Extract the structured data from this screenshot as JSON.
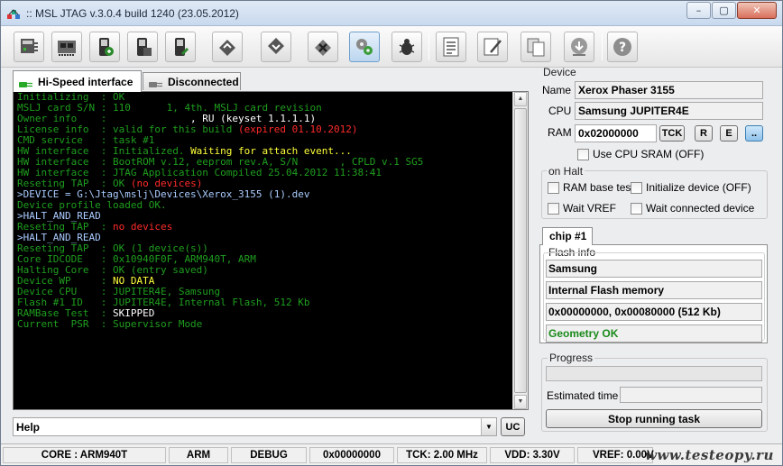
{
  "window": {
    "title": ":: MSL JTAG v.3.0.4 build 1240 (23.05.2012)",
    "controls": {
      "minimize": "–",
      "maximize": "▢",
      "close": "✕"
    }
  },
  "toolbar": {
    "buttons": [
      {
        "icon": "jtag-plug-icon"
      },
      {
        "icon": "board-chip-icon"
      },
      {
        "icon": "phone-read-icon"
      },
      {
        "icon": "phone-write-icon"
      },
      {
        "icon": "phone-erase-icon"
      },
      {
        "icon": "chip-up-icon"
      },
      {
        "icon": "chip-down-icon"
      },
      {
        "icon": "chip-x-icon"
      },
      {
        "icon": "settings-gears-icon"
      },
      {
        "icon": "bug-debug-icon"
      },
      {
        "icon": "log-list-icon"
      },
      {
        "icon": "notepad-edit-icon"
      },
      {
        "icon": "copy-pages-icon"
      },
      {
        "icon": "globe-update-icon"
      },
      {
        "icon": "help-icon"
      }
    ]
  },
  "tabs": {
    "hispeed": "Hi-Speed interface",
    "disconnected": "Disconnected"
  },
  "console": {
    "lines": [
      {
        "label": "Initializing  : ",
        "value": "OK",
        "color": "#1f9e1f"
      },
      {
        "label": "MSLJ card S/N : ",
        "value": "110      1, 4th. MSLJ card revision",
        "color": "#1f9e1f"
      },
      {
        "label": "Owner info    : ",
        "value": "             , RU (keyset 1.1.1.1)",
        "color": "#ffffff"
      },
      {
        "label": "License info  : ",
        "value": "valid for this build ",
        "color": "#1f9e1f",
        "extra": "(expired 01.10.2012)",
        "extra_color": "#ff2a2a"
      },
      {
        "label": "CMD service   : ",
        "value": "task #1",
        "color": "#1f9e1f"
      },
      {
        "label": "HW interface  : ",
        "value": "Initialized. ",
        "color": "#1f9e1f",
        "extra": "Waiting for attach event...",
        "extra_color": "#ffff3a"
      },
      {
        "label": "HW interface  : ",
        "value": "BootROM v.12, eeprom rev.A, S/N       , CPLD v.1 SG5",
        "color": "#1f9e1f"
      },
      {
        "label": "HW interface  : ",
        "value": "JTAG Application Compiled 25.04.2012 11:38:41",
        "color": "#1f9e1f"
      },
      {
        "label": "Reseting TAP  : ",
        "value": "OK ",
        "color": "#1f9e1f",
        "extra": "(no devices)",
        "extra_color": "#ff2a2a"
      },
      {
        "label": "",
        "value": ">DEVICE = G:\\Jtag\\mslj\\Devices\\Xerox_3155 (1).dev",
        "color": "#aaccff"
      },
      {
        "label": "",
        "value": "Device profile loaded OK.",
        "color": "#1f9e1f"
      },
      {
        "label": "",
        "value": ">HALT_AND_READ",
        "color": "#aaccff"
      },
      {
        "label": "Reseting TAP  : ",
        "value": "no devices",
        "color": "#ff2a2a"
      },
      {
        "label": "",
        "value": ">HALT_AND_READ",
        "color": "#aaccff"
      },
      {
        "label": "Reseting TAP  : ",
        "value": "OK (1 device(s))",
        "color": "#1f9e1f"
      },
      {
        "label": "Core IDCODE   : ",
        "value": "0x10940F0F, ARM940T, ARM",
        "color": "#1f9e1f"
      },
      {
        "label": "Halting Core  : ",
        "value": "OK (entry saved)",
        "color": "#1f9e1f"
      },
      {
        "label": "Device WP     : ",
        "value": "NO DATA",
        "color": "#ffff3a"
      },
      {
        "label": "Device CPU    : ",
        "value": "JUPITER4E, Samsung",
        "color": "#1f9e1f"
      },
      {
        "label": "Flash #1 ID   : ",
        "value": "JUPITER4E, Internal Flash, 512 Kb",
        "color": "#1f9e1f"
      },
      {
        "label": "RAMBase Test  : ",
        "value": "SKIPPED",
        "color": "#ffffff"
      },
      {
        "label": "Current  PSR  : ",
        "value": "Supervisor Mode",
        "color": "#1f9e1f"
      }
    ],
    "label_color": "#1f9e1f"
  },
  "help": {
    "value": "Help",
    "uc_button": "UC"
  },
  "device": {
    "group_label": "Device",
    "name_label": "Name :",
    "name_value": "Xerox Phaser 3155",
    "cpu_label": "CPU :",
    "cpu_value": "Samsung JUPITER4E",
    "ram_label": "RAM :",
    "ram_value": "0x02000000",
    "tck_button": "TCK",
    "r_button": "R",
    "e_button": "E",
    "more_button": "..",
    "cpu_sram": "Use CPU SRAM (OFF)"
  },
  "on_halt": {
    "group_label": "on Halt",
    "ram_base_test": "RAM base test",
    "initialize_device": "Initialize device (OFF)",
    "wait_vref": "Wait VREF",
    "wait_connected": "Wait connected device"
  },
  "chip": {
    "tab_label": "chip #1",
    "flash_info_label": "Flash info",
    "manufacturer": "Samsung",
    "type": "Internal Flash memory",
    "range": "0x00000000, 0x00080000 (512 Kb)",
    "geometry": "Geometry OK"
  },
  "progress": {
    "group_label": "Progress",
    "fraction": 0.0,
    "estimated_label": "Estimated time :",
    "estimated_value": "",
    "stop_button": "Stop running task"
  },
  "status": {
    "core": "CORE : ARM940T",
    "arch": "ARM",
    "mode": "DEBUG",
    "address": "0x00000000",
    "tck": "TCK: 2.00 MHz",
    "vdd": "VDD: 3.30V",
    "vref": "VREF: 0.00V"
  },
  "watermark": "www.testeopy.ru",
  "colors": {
    "accent": "#3c7fb1",
    "geometry_ok": "#1a8a1a",
    "console_bg": "#000000"
  }
}
